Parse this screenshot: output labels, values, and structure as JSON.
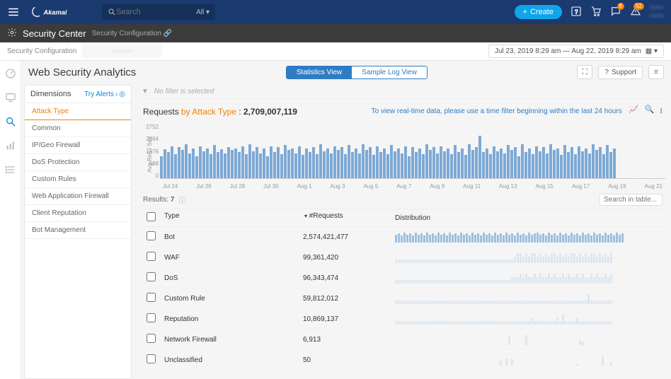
{
  "topbar": {
    "brand": "Akamai",
    "search_placeholder": "Search",
    "search_scope": "All",
    "create_label": "Create",
    "badge_chat": "8",
    "badge_alert": "52",
    "user_line1": "——",
    "user_line2": "——"
  },
  "subbar": {
    "title": "Security Center",
    "config": "Security Configuration"
  },
  "breadcrumb": {
    "label": "Security Configuration",
    "blurred": "———",
    "date_range": "Jul 23, 2019  8:29 am  —  Aug 22, 2019  8:29 am"
  },
  "page": {
    "title": "Web Security Analytics",
    "view_stats": "Statistics View",
    "view_log": "Sample Log View",
    "support": "Support"
  },
  "dimensions": {
    "header": "Dimensions",
    "try_alerts": "Try Alerts",
    "items": [
      "Attack Type",
      "Common",
      "IP/Geo Firewall",
      "DoS Protection",
      "Custom Rules",
      "Web Application Firewall",
      "Client Reputation",
      "Bot Management"
    ]
  },
  "filter_row": {
    "text": "No filter is selected"
  },
  "requests": {
    "prefix": "Requests",
    "by": "by Attack Type",
    "sep": " : ",
    "count": "2,709,007,119",
    "tip": "To view real-time data, please use a time filter beginning within the last 24 hours"
  },
  "chart_data": {
    "type": "bar",
    "ylabel": "Avg Req / Sec",
    "yticks": [
      "2752",
      "2064",
      "1376",
      "688",
      "0"
    ],
    "xlabels": [
      "Jul 24",
      "Jul 26",
      "Jul 28",
      "Jul 30",
      "Aug 1",
      "Aug 3",
      "Aug 5",
      "Aug 7",
      "Aug 9",
      "Aug 11",
      "Aug 13",
      "Aug 15",
      "Aug 17",
      "Aug 19",
      "Aug 21"
    ],
    "ylim": [
      0,
      2752
    ],
    "values": [
      1100,
      1450,
      1300,
      1600,
      1200,
      1550,
      1400,
      1700,
      1250,
      1500,
      1100,
      1600,
      1350,
      1500,
      1200,
      1650,
      1300,
      1450,
      1250,
      1550,
      1400,
      1500,
      1300,
      1600,
      1200,
      1700,
      1350,
      1550,
      1250,
      1500,
      1100,
      1600,
      1300,
      1550,
      1200,
      1650,
      1400,
      1500,
      1250,
      1600,
      1150,
      1500,
      1300,
      1550,
      1200,
      1700,
      1350,
      1500,
      1250,
      1600,
      1400,
      1550,
      1200,
      1650,
      1300,
      1500,
      1250,
      1700,
      1400,
      1550,
      1150,
      1600,
      1300,
      1500,
      1200,
      1650,
      1350,
      1500,
      1250,
      1600,
      1100,
      1550,
      1300,
      1500,
      1200,
      1700,
      1400,
      1550,
      1250,
      1600,
      1350,
      1500,
      1200,
      1650,
      1300,
      1500,
      1150,
      1700,
      1400,
      1550,
      2100,
      1300,
      1500,
      1200,
      1600,
      1350,
      1500,
      1250,
      1650,
      1400,
      1550,
      1100,
      1700,
      1300,
      1500,
      1200,
      1600,
      1350,
      1550,
      1250,
      1700,
      1400,
      1500,
      1150,
      1650,
      1300,
      1550,
      1200,
      1600,
      1350,
      1500,
      1250,
      1700,
      1400,
      1550,
      1200,
      1650,
      1300,
      1500
    ]
  },
  "results": {
    "label": "Results:",
    "count": "7",
    "search_placeholder": "Search in table...",
    "columns": {
      "type": "Type",
      "requests": "#Requests",
      "distribution": "Distribution"
    },
    "rows": [
      {
        "type": "Bot",
        "requests": "2,574,421,477",
        "dist": [
          8,
          9,
          7,
          10,
          8,
          9,
          7,
          10,
          8,
          9,
          7,
          10,
          8,
          9,
          7,
          10,
          8,
          9,
          7,
          10,
          8,
          9,
          7,
          10,
          8,
          9,
          7,
          10,
          8,
          9,
          7,
          10,
          8,
          9,
          7,
          10,
          8,
          9,
          7,
          10,
          8,
          9,
          7,
          10,
          8,
          9,
          7,
          10,
          8,
          9,
          10,
          8,
          9,
          7,
          10,
          8,
          9,
          7,
          10,
          8,
          9,
          7,
          10,
          8,
          9,
          7,
          10,
          8,
          9,
          7,
          10,
          8,
          9,
          7,
          10,
          8,
          9,
          7,
          10,
          8,
          9
        ],
        "low": false
      },
      {
        "type": "WAF",
        "requests": "99,361,420",
        "dist": [
          1,
          1,
          1,
          1,
          1,
          1,
          1,
          1,
          1,
          1,
          1,
          1,
          1,
          1,
          1,
          1,
          1,
          1,
          1,
          1,
          1,
          1,
          1,
          1,
          1,
          1,
          1,
          1,
          1,
          1,
          1,
          1,
          1,
          1,
          1,
          1,
          1,
          1,
          1,
          1,
          1,
          1,
          2,
          3,
          3,
          2,
          3,
          2,
          3,
          3,
          2,
          3,
          2,
          3,
          2,
          3,
          3,
          2,
          3,
          2,
          3,
          2,
          3,
          3,
          2,
          3,
          2,
          3,
          2,
          3,
          3,
          2,
          3,
          2,
          3,
          2,
          3
        ],
        "low": true
      },
      {
        "type": "DoS",
        "requests": "96,343,474",
        "dist": [
          1,
          1,
          1,
          1,
          1,
          1,
          1,
          1,
          1,
          1,
          1,
          1,
          1,
          1,
          1,
          1,
          1,
          1,
          1,
          1,
          1,
          1,
          1,
          1,
          1,
          1,
          1,
          1,
          1,
          1,
          1,
          1,
          1,
          1,
          1,
          1,
          1,
          1,
          1,
          1,
          1,
          2,
          2,
          2,
          3,
          2,
          3,
          2,
          2,
          3,
          2,
          3,
          2,
          2,
          3,
          2,
          3,
          2,
          2,
          3,
          2,
          3,
          2,
          2,
          3,
          2,
          3,
          2,
          2,
          3,
          2,
          3,
          2,
          2,
          3,
          2,
          3
        ],
        "low": true
      },
      {
        "type": "Custom Rule",
        "requests": "59,812,012",
        "dist": [
          1,
          1,
          1,
          1,
          1,
          1,
          1,
          1,
          1,
          1,
          1,
          1,
          1,
          1,
          1,
          1,
          1,
          1,
          1,
          1,
          1,
          1,
          1,
          1,
          1,
          1,
          1,
          1,
          1,
          1,
          1,
          1,
          1,
          1,
          1,
          1,
          1,
          1,
          1,
          1,
          1,
          1,
          1,
          1,
          1,
          1,
          1,
          1,
          1,
          1,
          1,
          1,
          1,
          1,
          1,
          1,
          1,
          1,
          1,
          1,
          1,
          1,
          1,
          1,
          1,
          1,
          1,
          1,
          3,
          1,
          1,
          1,
          1,
          1,
          1,
          1,
          1
        ],
        "low": true
      },
      {
        "type": "Reputation",
        "requests": "10,869,137",
        "dist": [
          1,
          1,
          1,
          1,
          1,
          1,
          1,
          1,
          1,
          1,
          1,
          1,
          1,
          1,
          1,
          1,
          1,
          1,
          1,
          1,
          1,
          1,
          1,
          1,
          1,
          1,
          1,
          1,
          1,
          1,
          1,
          1,
          1,
          1,
          1,
          1,
          1,
          1,
          1,
          1,
          1,
          1,
          1,
          1,
          1,
          1,
          1,
          1,
          2,
          1,
          1,
          1,
          1,
          1,
          1,
          1,
          1,
          2,
          1,
          3,
          1,
          1,
          1,
          1,
          2,
          1,
          1,
          1,
          1,
          1,
          1,
          1,
          1,
          1,
          1,
          1,
          1
        ],
        "low": true
      },
      {
        "type": "Network Firewall",
        "requests": "6,913",
        "dist": [
          0,
          0,
          0,
          0,
          0,
          0,
          0,
          0,
          0,
          0,
          0,
          0,
          0,
          0,
          0,
          0,
          0,
          0,
          0,
          0,
          0,
          0,
          0,
          0,
          0,
          0,
          0,
          0,
          0,
          0,
          0,
          0,
          0,
          0,
          0,
          0,
          0,
          0,
          0,
          0,
          5,
          0,
          0,
          0,
          0,
          0,
          6,
          0,
          0,
          0,
          0,
          0,
          0,
          0,
          0,
          0,
          0,
          0,
          0,
          0,
          0,
          0,
          0,
          0,
          0,
          3,
          2,
          0,
          0,
          0,
          0,
          0,
          0,
          0,
          0,
          0,
          0
        ],
        "low": true
      },
      {
        "type": "Unclassified",
        "requests": "50",
        "dist": [
          0,
          0,
          0,
          0,
          0,
          0,
          0,
          0,
          0,
          0,
          0,
          0,
          0,
          0,
          0,
          0,
          0,
          0,
          0,
          0,
          0,
          0,
          0,
          0,
          0,
          0,
          0,
          0,
          0,
          0,
          0,
          0,
          0,
          0,
          0,
          0,
          0,
          4,
          0,
          6,
          0,
          5,
          0,
          0,
          0,
          0,
          0,
          0,
          0,
          0,
          0,
          0,
          0,
          0,
          0,
          0,
          0,
          0,
          0,
          0,
          0,
          0,
          0,
          0,
          1,
          0,
          0,
          0,
          0,
          0,
          0,
          0,
          0,
          8,
          0,
          0,
          3
        ],
        "low": true
      }
    ]
  }
}
